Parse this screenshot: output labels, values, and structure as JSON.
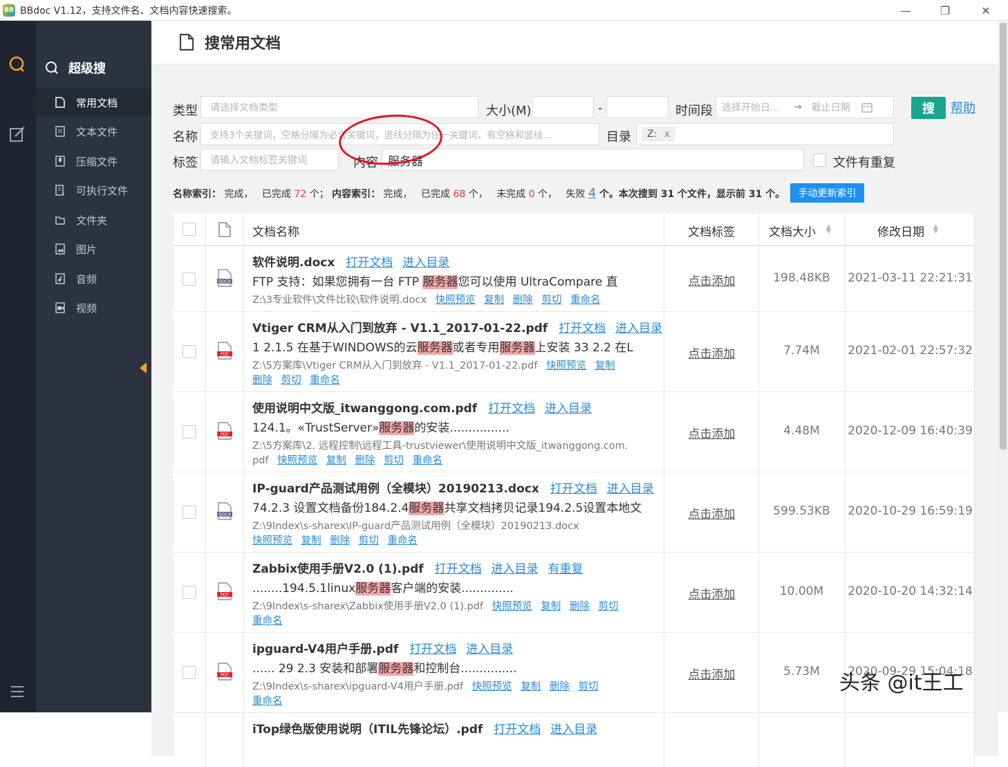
{
  "window": {
    "title": "BBdoc V1.12，支持文件名、文档内容快速搜索。",
    "logo_text": "BB",
    "minimize": "—",
    "maximize": "❐",
    "close": "✕"
  },
  "sidebar": {
    "title": "超级搜",
    "items": [
      {
        "label": "常用文档",
        "icon": "document-icon"
      },
      {
        "label": "文本文件",
        "icon": "text-file-icon"
      },
      {
        "label": "压缩文件",
        "icon": "archive-icon"
      },
      {
        "label": "可执行文件",
        "icon": "executable-icon"
      },
      {
        "label": "文件夹",
        "icon": "folder-icon"
      },
      {
        "label": "图片",
        "icon": "image-icon"
      },
      {
        "label": "音频",
        "icon": "audio-icon"
      },
      {
        "label": "视频",
        "icon": "video-icon"
      }
    ]
  },
  "page": {
    "title": "搜常用文档"
  },
  "filters": {
    "type_label": "类型",
    "type_placeholder": "请选择文档类型",
    "size_label": "大小(M)",
    "size_sep": "-",
    "time_label": "时间段",
    "date_start": "选择开始日...",
    "date_arrow": "→",
    "date_end": "截止日期",
    "name_label": "名称",
    "name_placeholder": "支持3个关键词，空格分隔为必含关键词，竖线分隔为任一关键词，有空格和竖线...",
    "dir_label": "目录",
    "dir_tag": "Z:",
    "dir_tag_close": "x",
    "tag_label": "标签",
    "tag_placeholder": "请输入文档标签关键词",
    "content_label": "内容",
    "content_value": "服务器",
    "dup_label": "文件有重复",
    "search_button": "搜",
    "help_link": "帮助"
  },
  "status": {
    "name_index_label": "名称索引：",
    "name_state": "完成，",
    "done_prefix": "已完成",
    "name_done": "72",
    "unit_sep": "个；",
    "content_index_label": "内容索引：",
    "content_state": "完成，",
    "content_done": "68",
    "unit_comma": "个，",
    "undone_prefix": "未完成",
    "content_undone": "0",
    "fail_prefix": "失败",
    "content_fail": "4",
    "summary": "个。本次搜到 31 个文件，显示前 31 个。",
    "reindex_button": "手动更新索引"
  },
  "table": {
    "headers": {
      "name": "文档名称",
      "tag": "文档标签",
      "size": "文档大小",
      "date": "修改日期"
    },
    "rows": [
      {
        "title": "软件说明.docx",
        "open": "打开文档",
        "enter": "进入目录",
        "icon": "docx-file-icon",
        "icon_label": "DOCX",
        "snip_pre": "FTP 支持：如果您拥有一台 FTP ",
        "snip_hl": "服务器",
        "snip_post": "您可以使用 UltraCompare 直",
        "path": "Z:\\3专业软件\\文件比较\\软件说明.docx",
        "a1": "快照预览",
        "a2": "复制",
        "a3": "删除",
        "a4": "剪切",
        "a5": "重命名",
        "tag": "点击添加",
        "size": "198.48KB",
        "date": "2021-03-11 22:21:31"
      },
      {
        "title": "Vtiger CRM从入门到放弃 - V1.1_2017-01-22.pdf",
        "open": "打开文档",
        "enter": "进入目录",
        "icon": "pdf-file-icon",
        "icon_label": "PDF",
        "snip_pre": "1 2.1.5 在基于WINDOWS的云",
        "snip_hl": "服务器",
        "snip_mid": "或者专用",
        "snip_hl2": "服务器",
        "snip_post": "上安装 33 2.2 在L",
        "path": "Z:\\5方案库\\Vtiger CRM从入门到放弃 - V1.1_2017-01-22.pdf",
        "a1": "快照预览",
        "a2": "复制",
        "a3": "删除",
        "a4": "剪切",
        "a5": "重命名",
        "tag": "点击添加",
        "size": "7.74M",
        "date": "2021-02-01 22:57:32"
      },
      {
        "title": "使用说明中文版_itwanggong.com.pdf",
        "open": "打开文档",
        "enter": "进入目录",
        "icon": "pdf-file-icon",
        "icon_label": "PDF",
        "snip_pre": "124.1。«TrustServer»",
        "snip_hl": "服务器",
        "snip_post": "的安装................",
        "path": "Z:\\5方案库\\2. 远程控制\\远程工具-trustviewer\\使用说明中文版_itwanggong.com.",
        "path_cont": "pdf",
        "a1": "快照预览",
        "a2": "复制",
        "a3": "删除",
        "a4": "剪切",
        "a5": "重命名",
        "tag": "点击添加",
        "size": "4.48M",
        "date": "2020-12-09 16:40:39"
      },
      {
        "title": "IP-guard产品测试用例（全模块）20190213.docx",
        "open": "打开文档",
        "enter": "进入目录",
        "icon": "docx-file-icon",
        "icon_label": "DOCX",
        "snip_pre": "74.2.3 设置文档备份184.2.4",
        "snip_hl": "服务器",
        "snip_post": "共享文档拷贝记录194.2.5设置本地文",
        "path": "Z:\\9Index\\s-sharex\\IP-guard产品测试用例（全模块）20190213.docx",
        "a1": "快照预览",
        "a2": "复制",
        "a3": "删除",
        "a4": "剪切",
        "a5": "重命名",
        "tag": "点击添加",
        "size": "599.53KB",
        "date": "2020-10-29 16:59:19"
      },
      {
        "title": "Zabbix使用手册V2.0 (1).pdf",
        "open": "打开文档",
        "enter": "进入目录",
        "dup": "有重复",
        "icon": "pdf-file-icon",
        "icon_label": "PDF",
        "snip_pre": "........194.5.1linux",
        "snip_hl": "服务器",
        "snip_post": "客户端的安装..............",
        "path": "Z:\\9Index\\s-sharex\\Zabbix使用手册V2.0 (1).pdf",
        "a1": "快照预览",
        "a2": "复制",
        "a3": "删除",
        "a4": "剪切",
        "a5": "重命名",
        "tag": "点击添加",
        "size": "10.00M",
        "date": "2020-10-20 14:32:14"
      },
      {
        "title": "ipguard-V4用户手册.pdf",
        "open": "打开文档",
        "enter": "进入目录",
        "icon": "pdf-file-icon",
        "icon_label": "PDF",
        "snip_pre": "...... 29 2.3 安装和部署",
        "snip_hl": "服务器",
        "snip_post": "和控制台...............",
        "path": "Z:\\9Index\\s-sharex\\ipguard-V4用户手册.pdf",
        "a1": "快照预览",
        "a2": "复制",
        "a3": "删除",
        "a4": "剪切",
        "a5": "重命名",
        "tag": "点击添加",
        "size": "5.73M",
        "date": "2020-09-29 15:04:18"
      },
      {
        "title": "iTop绿色版使用说明（ITIL先锋论坛）.pdf",
        "open": "打开文档",
        "enter": "进入目录"
      }
    ]
  },
  "watermark": "头条 @it王工",
  "colors": {
    "accent": "#19a68e",
    "link": "#2a8bd8",
    "highlight": "#f4a6a6",
    "rail": "#202430",
    "sidebar": "#2c323f",
    "handle": "#f0a030",
    "annotation": "#e1141e"
  }
}
